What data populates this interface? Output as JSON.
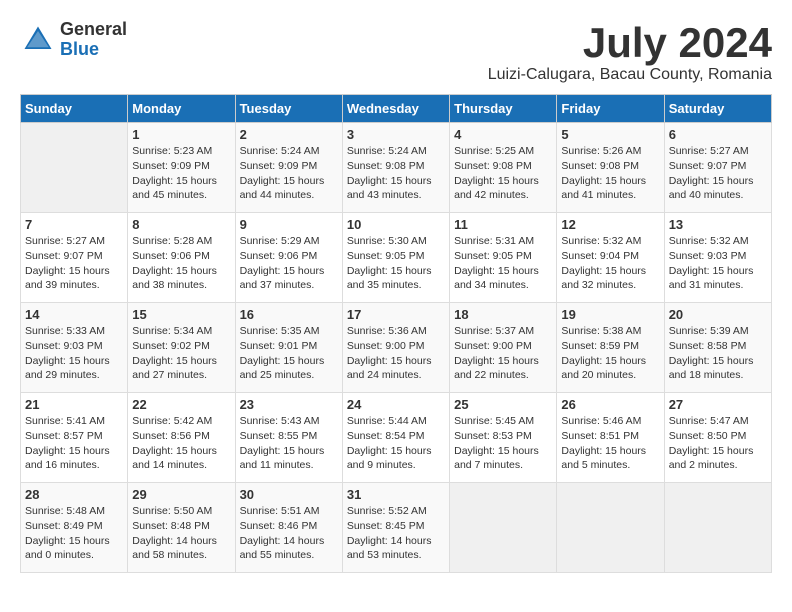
{
  "header": {
    "logo": {
      "general": "General",
      "blue": "Blue"
    },
    "title": "July 2024",
    "subtitle": "Luizi-Calugara, Bacau County, Romania"
  },
  "calendar": {
    "days_of_week": [
      "Sunday",
      "Monday",
      "Tuesday",
      "Wednesday",
      "Thursday",
      "Friday",
      "Saturday"
    ],
    "weeks": [
      [
        {
          "day": "",
          "info": ""
        },
        {
          "day": "1",
          "info": "Sunrise: 5:23 AM\nSunset: 9:09 PM\nDaylight: 15 hours\nand 45 minutes."
        },
        {
          "day": "2",
          "info": "Sunrise: 5:24 AM\nSunset: 9:09 PM\nDaylight: 15 hours\nand 44 minutes."
        },
        {
          "day": "3",
          "info": "Sunrise: 5:24 AM\nSunset: 9:08 PM\nDaylight: 15 hours\nand 43 minutes."
        },
        {
          "day": "4",
          "info": "Sunrise: 5:25 AM\nSunset: 9:08 PM\nDaylight: 15 hours\nand 42 minutes."
        },
        {
          "day": "5",
          "info": "Sunrise: 5:26 AM\nSunset: 9:08 PM\nDaylight: 15 hours\nand 41 minutes."
        },
        {
          "day": "6",
          "info": "Sunrise: 5:27 AM\nSunset: 9:07 PM\nDaylight: 15 hours\nand 40 minutes."
        }
      ],
      [
        {
          "day": "7",
          "info": "Sunrise: 5:27 AM\nSunset: 9:07 PM\nDaylight: 15 hours\nand 39 minutes."
        },
        {
          "day": "8",
          "info": "Sunrise: 5:28 AM\nSunset: 9:06 PM\nDaylight: 15 hours\nand 38 minutes."
        },
        {
          "day": "9",
          "info": "Sunrise: 5:29 AM\nSunset: 9:06 PM\nDaylight: 15 hours\nand 37 minutes."
        },
        {
          "day": "10",
          "info": "Sunrise: 5:30 AM\nSunset: 9:05 PM\nDaylight: 15 hours\nand 35 minutes."
        },
        {
          "day": "11",
          "info": "Sunrise: 5:31 AM\nSunset: 9:05 PM\nDaylight: 15 hours\nand 34 minutes."
        },
        {
          "day": "12",
          "info": "Sunrise: 5:32 AM\nSunset: 9:04 PM\nDaylight: 15 hours\nand 32 minutes."
        },
        {
          "day": "13",
          "info": "Sunrise: 5:32 AM\nSunset: 9:03 PM\nDaylight: 15 hours\nand 31 minutes."
        }
      ],
      [
        {
          "day": "14",
          "info": "Sunrise: 5:33 AM\nSunset: 9:03 PM\nDaylight: 15 hours\nand 29 minutes."
        },
        {
          "day": "15",
          "info": "Sunrise: 5:34 AM\nSunset: 9:02 PM\nDaylight: 15 hours\nand 27 minutes."
        },
        {
          "day": "16",
          "info": "Sunrise: 5:35 AM\nSunset: 9:01 PM\nDaylight: 15 hours\nand 25 minutes."
        },
        {
          "day": "17",
          "info": "Sunrise: 5:36 AM\nSunset: 9:00 PM\nDaylight: 15 hours\nand 24 minutes."
        },
        {
          "day": "18",
          "info": "Sunrise: 5:37 AM\nSunset: 9:00 PM\nDaylight: 15 hours\nand 22 minutes."
        },
        {
          "day": "19",
          "info": "Sunrise: 5:38 AM\nSunset: 8:59 PM\nDaylight: 15 hours\nand 20 minutes."
        },
        {
          "day": "20",
          "info": "Sunrise: 5:39 AM\nSunset: 8:58 PM\nDaylight: 15 hours\nand 18 minutes."
        }
      ],
      [
        {
          "day": "21",
          "info": "Sunrise: 5:41 AM\nSunset: 8:57 PM\nDaylight: 15 hours\nand 16 minutes."
        },
        {
          "day": "22",
          "info": "Sunrise: 5:42 AM\nSunset: 8:56 PM\nDaylight: 15 hours\nand 14 minutes."
        },
        {
          "day": "23",
          "info": "Sunrise: 5:43 AM\nSunset: 8:55 PM\nDaylight: 15 hours\nand 11 minutes."
        },
        {
          "day": "24",
          "info": "Sunrise: 5:44 AM\nSunset: 8:54 PM\nDaylight: 15 hours\nand 9 minutes."
        },
        {
          "day": "25",
          "info": "Sunrise: 5:45 AM\nSunset: 8:53 PM\nDaylight: 15 hours\nand 7 minutes."
        },
        {
          "day": "26",
          "info": "Sunrise: 5:46 AM\nSunset: 8:51 PM\nDaylight: 15 hours\nand 5 minutes."
        },
        {
          "day": "27",
          "info": "Sunrise: 5:47 AM\nSunset: 8:50 PM\nDaylight: 15 hours\nand 2 minutes."
        }
      ],
      [
        {
          "day": "28",
          "info": "Sunrise: 5:48 AM\nSunset: 8:49 PM\nDaylight: 15 hours\nand 0 minutes."
        },
        {
          "day": "29",
          "info": "Sunrise: 5:50 AM\nSunset: 8:48 PM\nDaylight: 14 hours\nand 58 minutes."
        },
        {
          "day": "30",
          "info": "Sunrise: 5:51 AM\nSunset: 8:46 PM\nDaylight: 14 hours\nand 55 minutes."
        },
        {
          "day": "31",
          "info": "Sunrise: 5:52 AM\nSunset: 8:45 PM\nDaylight: 14 hours\nand 53 minutes."
        },
        {
          "day": "",
          "info": ""
        },
        {
          "day": "",
          "info": ""
        },
        {
          "day": "",
          "info": ""
        }
      ]
    ]
  }
}
